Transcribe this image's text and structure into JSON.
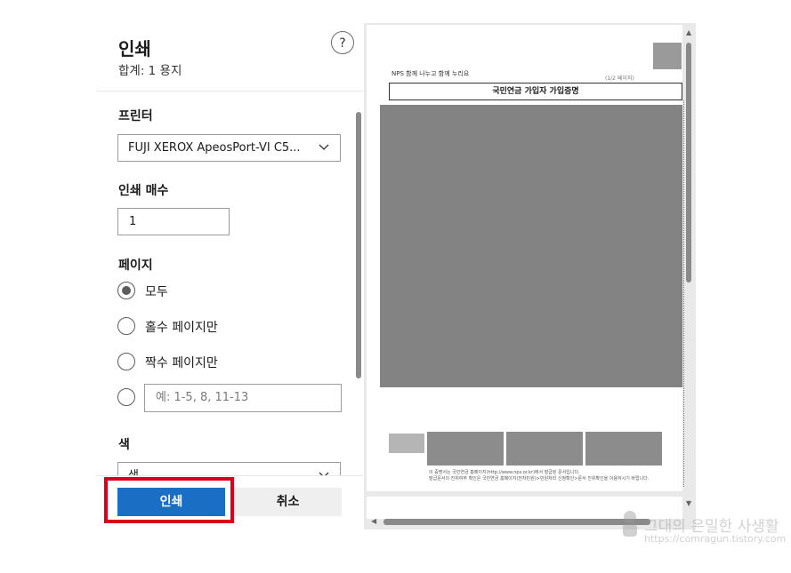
{
  "dialog": {
    "title": "인쇄",
    "subtitle": "합계: 1 용지",
    "help_label": "?"
  },
  "printer": {
    "label": "프린터",
    "selected": "FUJI XEROX ApeosPort-VI C5..."
  },
  "copies": {
    "label": "인쇄 매수",
    "value": "1"
  },
  "pages": {
    "label": "페이지",
    "options": [
      {
        "label": "모두",
        "selected": true
      },
      {
        "label": "홀수 페이지만",
        "selected": false
      },
      {
        "label": "짝수 페이지만",
        "selected": false
      }
    ],
    "custom_placeholder": "예: 1-5, 8, 11-13"
  },
  "color": {
    "label": "색",
    "selected": "색"
  },
  "footer": {
    "print_label": "인쇄",
    "cancel_label": "취소"
  },
  "preview": {
    "doc_header": "NPS 함께 나누고 함께 누리요",
    "doc_page": "(1/2 페이지)",
    "doc_title": "국민연금 가입자 가입증명",
    "doc_foot1": "이 증명서는 국민연금 홈페이지(http://www.nps.or.kr)에서 발급된 문서입니다.",
    "doc_foot2": "발급문서의 진위여부 확인은 국민연금 홈페이지(전자민원)>민원처리 신청확인>문서 진위확인을 이용하시기 바랍니다."
  },
  "watermark": {
    "line1": "그대의 은밀한 사생활",
    "line2": "https://comragun.tistory.com"
  },
  "colors": {
    "accent": "#1a6fc4",
    "highlight": "#d9001b"
  }
}
